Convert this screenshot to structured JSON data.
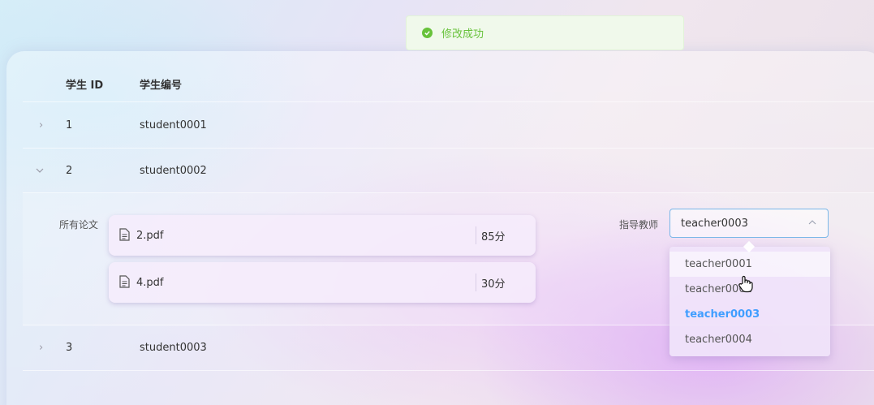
{
  "toast": {
    "message": "修改成功",
    "color": "#67c23a"
  },
  "table": {
    "headers": {
      "id": "学生 ID",
      "code": "学生编号"
    },
    "rows": [
      {
        "id": "1",
        "code": "student0001",
        "expanded": false
      },
      {
        "id": "2",
        "code": "student0002",
        "expanded": true
      },
      {
        "id": "3",
        "code": "student0003",
        "expanded": false
      }
    ]
  },
  "expanded": {
    "papers_label": "所有论文",
    "papers": [
      {
        "file": "2.pdf",
        "score": "85分"
      },
      {
        "file": "4.pdf",
        "score": "30分"
      }
    ],
    "advisor_label": "指导教师",
    "advisor_value": "teacher0003",
    "advisor_options": [
      "teacher0001",
      "teacher0002",
      "teacher0003",
      "teacher0004"
    ],
    "selected_index": 2,
    "hover_index": 0,
    "accent": "#409eff"
  }
}
